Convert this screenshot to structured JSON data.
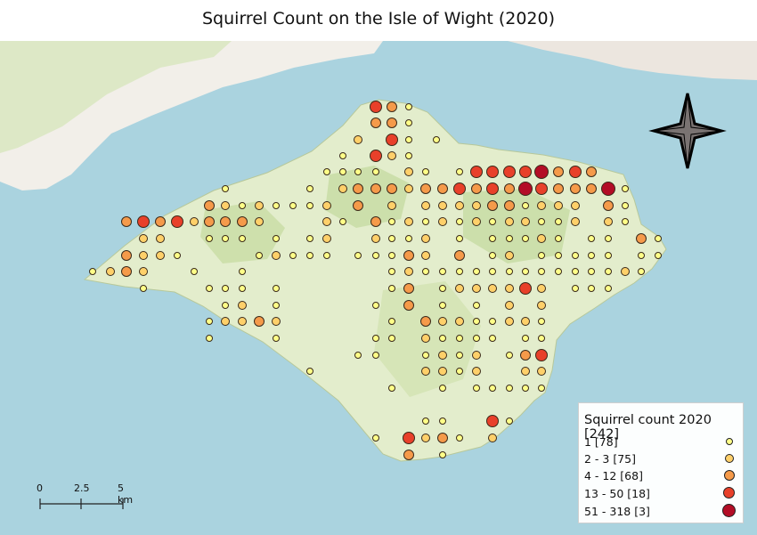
{
  "title": "Squirrel Count on the Isle of Wight (2020)",
  "colors": {
    "sea": "#aad3df",
    "land": "#f2efe9",
    "island": "#e3edcc",
    "woodland": "#c8dca4",
    "classes": [
      "#ffff88",
      "#fed06a",
      "#f59a4a",
      "#e8402a",
      "#b30d26"
    ]
  },
  "compass_icon": "north-arrow-star-icon",
  "scale_bar": {
    "labels": [
      "0",
      "2.5",
      "5 km"
    ]
  },
  "legend": {
    "title": "Squirrel count 2020 [242]",
    "entries": [
      {
        "label": "1 [78]"
      },
      {
        "label": "2 - 3 [75]"
      },
      {
        "label": "4 - 12 [68]"
      },
      {
        "label": "13 - 50 [18]"
      },
      {
        "label": "51 - 318 [3]"
      }
    ]
  }
}
